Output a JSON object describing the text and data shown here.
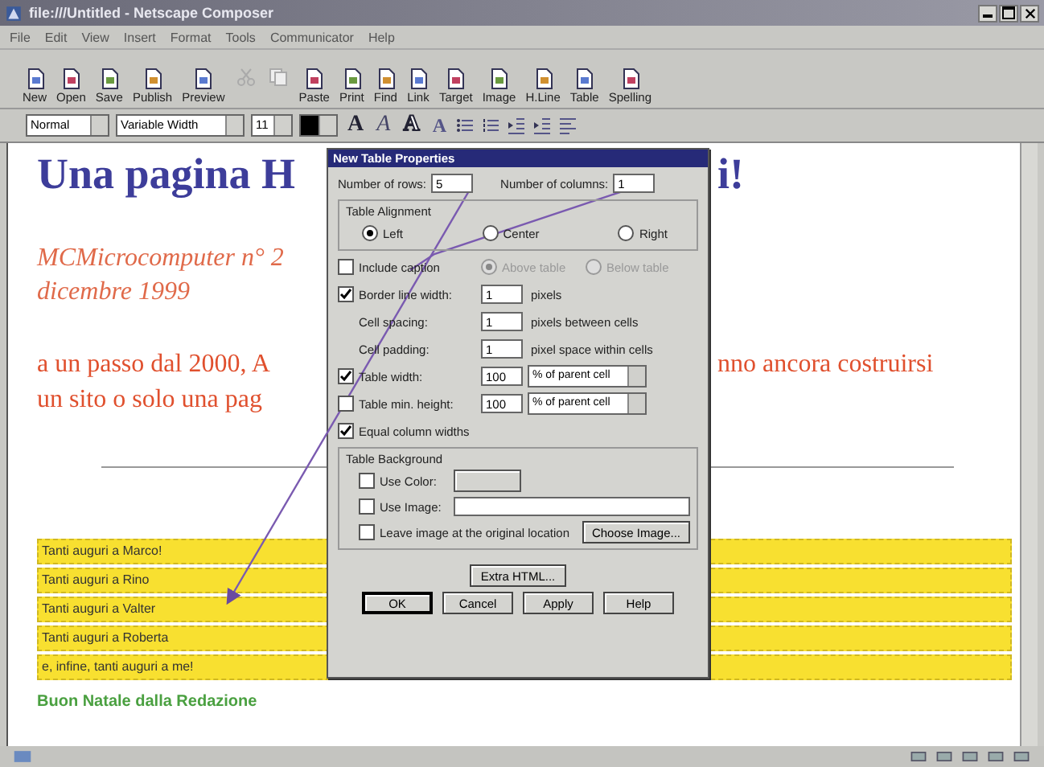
{
  "window": {
    "title": "file:///Untitled - Netscape Composer"
  },
  "menu": [
    "File",
    "Edit",
    "View",
    "Insert",
    "Format",
    "Tools",
    "Communicator",
    "Help"
  ],
  "toolbar": [
    {
      "label": "New"
    },
    {
      "label": "Open"
    },
    {
      "label": "Save"
    },
    {
      "label": "Publish"
    },
    {
      "label": "Preview"
    },
    {
      "label": "Paste"
    },
    {
      "label": "Print"
    },
    {
      "label": "Find"
    },
    {
      "label": "Link"
    },
    {
      "label": "Target"
    },
    {
      "label": "Image"
    },
    {
      "label": "H.Line"
    },
    {
      "label": "Table"
    },
    {
      "label": "Spelling"
    }
  ],
  "format_bar": {
    "paragraph_style": "Normal",
    "font": "Variable Width",
    "size": "11",
    "text_buttons": [
      {
        "glyph": "A",
        "kind": "bold"
      },
      {
        "glyph": "A",
        "kind": "italic"
      },
      {
        "glyph": "A",
        "kind": "outline"
      },
      {
        "glyph": "A",
        "kind": "super"
      }
    ]
  },
  "page": {
    "heading": {
      "left": "Una pagina H",
      "right": "i!"
    },
    "subtitle": [
      "MCMicrocomputer n° 2",
      "dicembre 1999"
    ],
    "paragraph": [
      {
        "left": "a un passo dal 2000, A",
        "right": "nno ancora costruirsi"
      },
      {
        "left": "un sito o solo una pag"
      }
    ],
    "table_rows": [
      "Tanti auguri a Marco!",
      "Tanti auguri a Rino",
      "Tanti auguri a Valter",
      "Tanti auguri a Roberta",
      "e, infine, tanti auguri a me!"
    ],
    "footer": "Buon Natale dalla Redazione"
  },
  "dialog": {
    "title": "New Table Properties",
    "rows": {
      "label": "Number of rows:",
      "value": "5"
    },
    "columns": {
      "label": "Number of columns:",
      "value": "1"
    },
    "alignment": {
      "label": "Table Alignment",
      "options": [
        {
          "label": "Left",
          "selected": true
        },
        {
          "label": "Center",
          "selected": false
        },
        {
          "label": "Right",
          "selected": false
        }
      ]
    },
    "caption": {
      "label": "Include caption",
      "checked": false,
      "disabled": true,
      "positions": [
        {
          "label": "Above table",
          "selected": true
        },
        {
          "label": "Below table",
          "selected": false
        }
      ]
    },
    "spacing": [
      {
        "kind": "check",
        "label": "Border line width:",
        "checked": true,
        "value": "1",
        "unit": "pixels"
      },
      {
        "kind": "plain",
        "label": "Cell spacing:",
        "value": "1",
        "unit": "pixels between cells"
      },
      {
        "kind": "plain",
        "label": "Cell padding:",
        "value": "1",
        "unit": "pixel space within cells"
      }
    ],
    "size": [
      {
        "label": "Table width:",
        "checked": true,
        "value": "100",
        "unit": "% of parent cell"
      },
      {
        "label": "Table min. height:",
        "checked": false,
        "value": "100",
        "unit": "% of parent cell"
      }
    ],
    "equal_widths": {
      "label": "Equal column widths",
      "checked": true
    },
    "background": {
      "label": "Table Background",
      "use_color": {
        "label": "Use Color:",
        "checked": false
      },
      "use_image": {
        "label": "Use Image:",
        "checked": false
      },
      "leave_image": {
        "label": "Leave image at the original location",
        "checked": false
      },
      "choose_button": "Choose Image..."
    },
    "extra_button": "Extra HTML...",
    "buttons": [
      "OK",
      "Cancel",
      "Apply",
      "Help"
    ]
  }
}
